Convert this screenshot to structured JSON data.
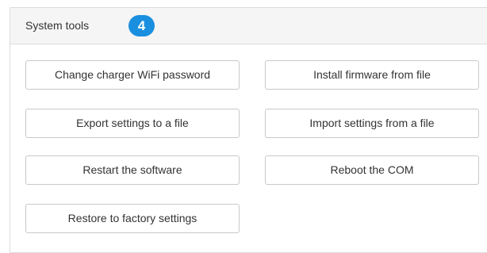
{
  "panel": {
    "title": "System tools",
    "step_number": "4",
    "badge_color": "#1a8fe0"
  },
  "buttons": {
    "change_wifi_password": "Change charger WiFi password",
    "install_firmware": "Install firmware from file",
    "export_settings": "Export settings to a file",
    "import_settings": "Import settings from a file",
    "restart_software": "Restart the software",
    "reboot_com": "Reboot the COM",
    "factory_reset": "Restore to factory settings"
  }
}
